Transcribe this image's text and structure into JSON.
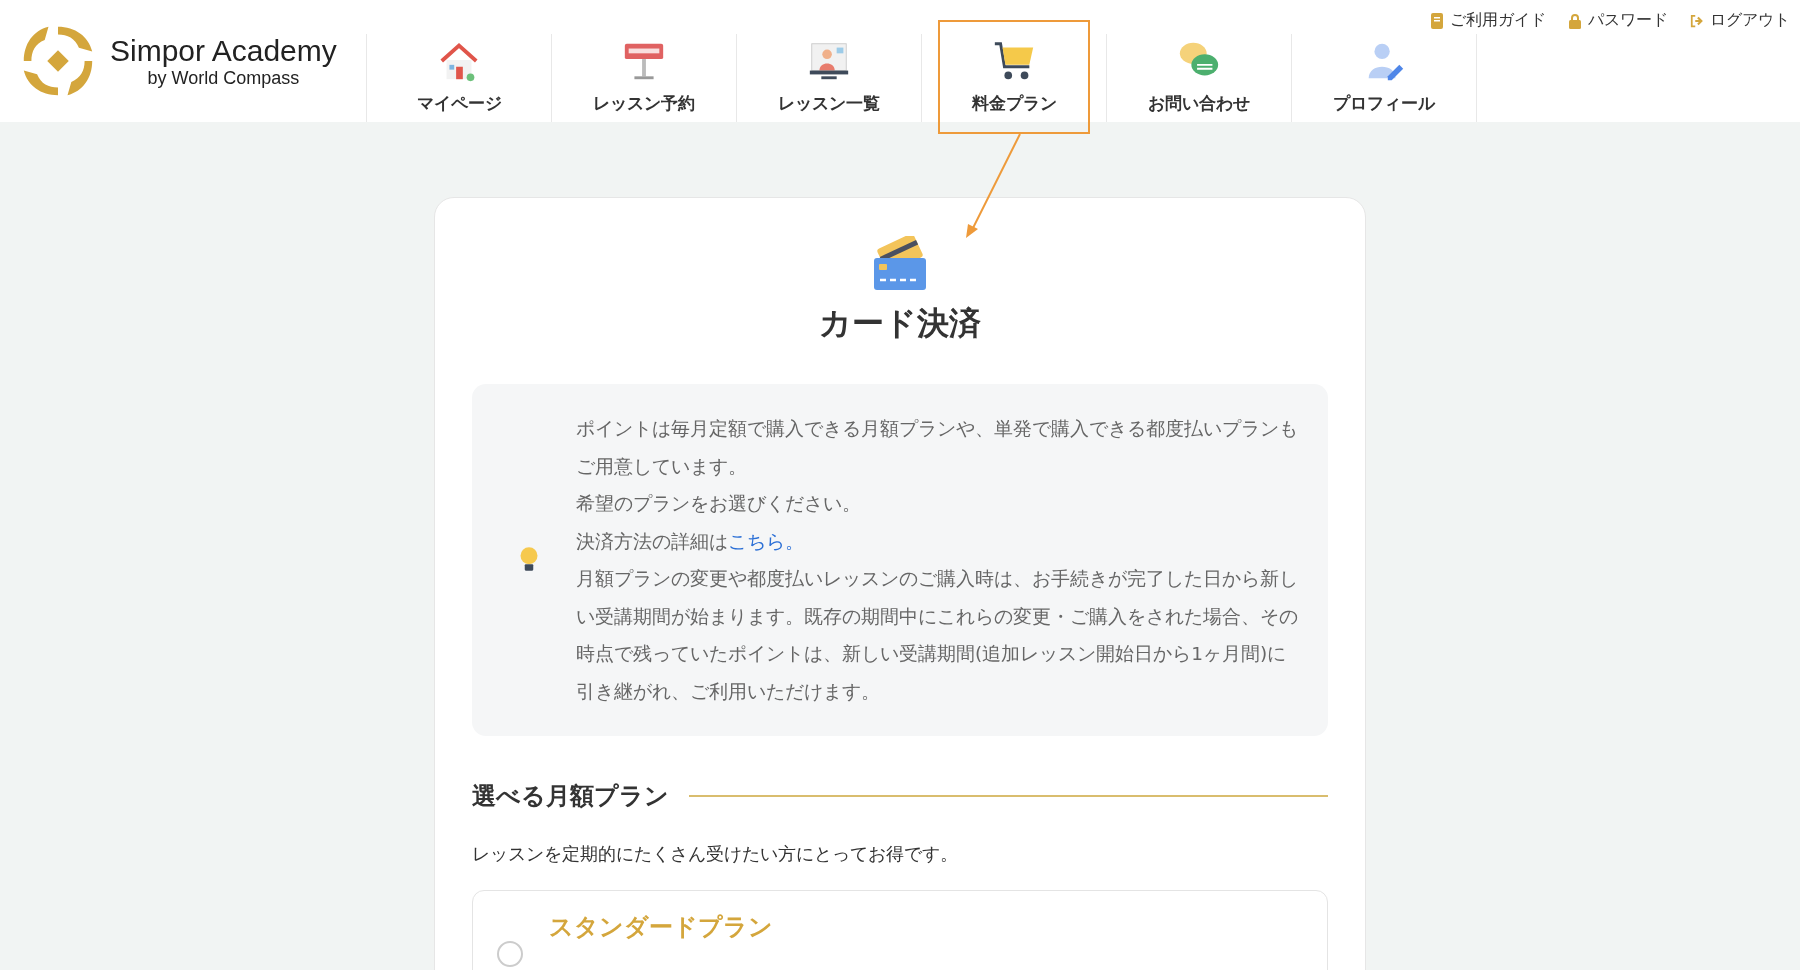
{
  "logo": {
    "name": "Simpor Academy",
    "tagline": "by World Compass"
  },
  "top_links": [
    {
      "kind": "guide",
      "label": "ご利用ガイド"
    },
    {
      "kind": "password",
      "label": "パスワード"
    },
    {
      "kind": "logout",
      "label": "ログアウト"
    }
  ],
  "nav": [
    {
      "kind": "home",
      "label": "マイページ",
      "selected": false
    },
    {
      "kind": "reserve",
      "label": "レッスン予約",
      "selected": false
    },
    {
      "kind": "lessons",
      "label": "レッスン一覧",
      "selected": false
    },
    {
      "kind": "cart",
      "label": "料金プラン",
      "selected": true
    },
    {
      "kind": "contact",
      "label": "お問い合わせ",
      "selected": false
    },
    {
      "kind": "profile",
      "label": "プロフィール",
      "selected": false
    }
  ],
  "page_title": "カード決済",
  "info": [
    {
      "text": "ポイントは毎月定額で購入できる月額プランや、単発で購入できる都度払いプランもご用意しています。"
    },
    {
      "text": "希望のプランをお選びください。"
    },
    {
      "text": "決済方法の詳細は",
      "link": "こちら。"
    },
    {
      "text": "月額プランの変更や都度払いレッスンのご購入時は、お手続きが完了した日から新しい受講期間が始まります。既存の期間中にこれらの変更・ご購入をされた場合、その時点で残っていたポイントは、新しい受講期間(追加レッスン開始日から1ヶ月間)に引き継がれ、ご利用いただけます。"
    }
  ],
  "section": {
    "title": "選べる月額プラン",
    "description": "レッスンを定期的にたくさん受けたい方にとってお得です。"
  },
  "plans": [
    {
      "name": "スタンダードプラン",
      "selected": false
    }
  ]
}
